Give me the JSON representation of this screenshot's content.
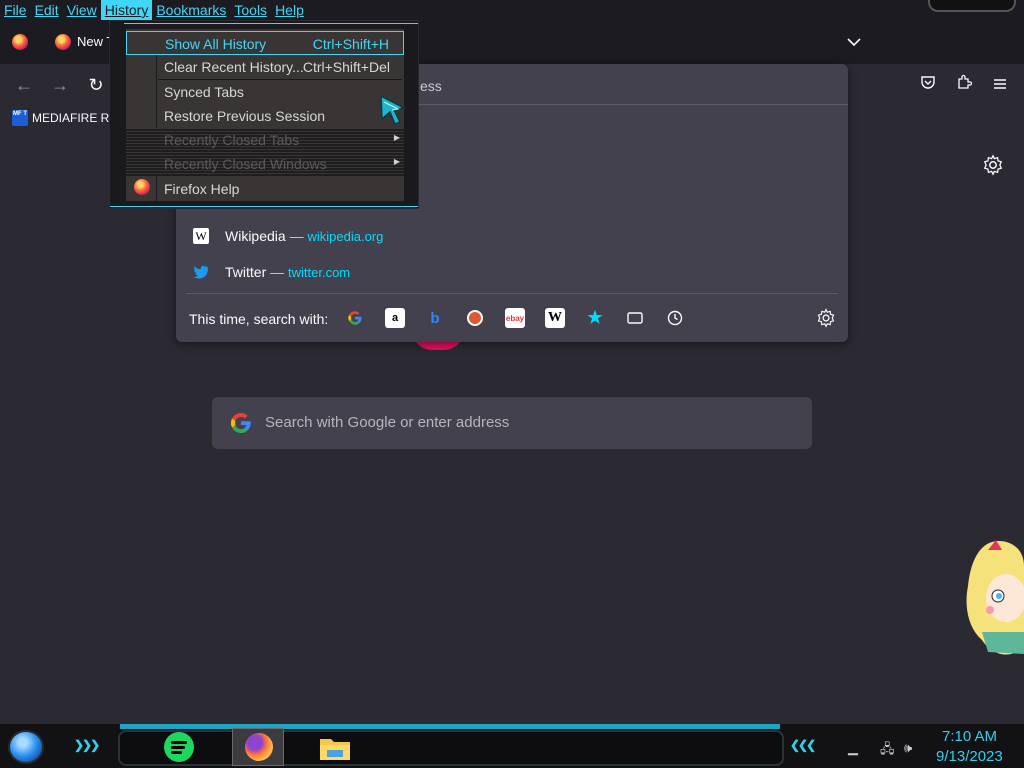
{
  "menubar": {
    "items": [
      "File",
      "Edit",
      "View",
      "History",
      "Bookmarks",
      "Tools",
      "Help"
    ]
  },
  "tabs": [
    {
      "label": "New T"
    }
  ],
  "toolbar": {
    "back_icon": "back-arrow-icon",
    "forward_icon": "forward-arrow-icon",
    "reload_icon": "reload-icon",
    "right_icons": [
      "pocket-icon",
      "extensions-icon",
      "menu-icon"
    ]
  },
  "bookmarks": [
    {
      "label": "MEDIAFIRE RO",
      "icon_text": "MF T"
    }
  ],
  "url_panel": {
    "input_text": "ess",
    "suggestions": [
      {
        "title": "Wikipedia",
        "dash": "—",
        "url": "wikipedia.org",
        "icon": "wikipedia-icon"
      },
      {
        "title": "Twitter",
        "dash": "—",
        "url": "twitter.com",
        "icon": "twitter-icon"
      }
    ],
    "search_with_label": "This time, search with:",
    "engines": [
      "google-icon",
      "amazon-icon",
      "bing-icon",
      "duckduckgo-icon",
      "ebay-icon",
      "wikipedia-icon",
      "bookmarks-star-icon",
      "tabs-icon",
      "history-clock-icon"
    ]
  },
  "main_search": {
    "placeholder": "Search with Google or enter address"
  },
  "history_menu": {
    "items": [
      {
        "label": "Show All History",
        "accel": "Ctrl+Shift+H",
        "state": "selected"
      },
      {
        "label": "Clear Recent History...",
        "accel": "Ctrl+Shift+Del",
        "state": "normal"
      },
      {
        "label": "Synced Tabs",
        "accel": "",
        "state": "normal"
      },
      {
        "label": "Restore Previous Session",
        "accel": "",
        "state": "normal"
      },
      {
        "label": "Recently Closed Tabs",
        "accel": "",
        "state": "disabled",
        "submenu": true
      },
      {
        "label": "Recently Closed Windows",
        "accel": "",
        "state": "disabled",
        "submenu": true
      },
      {
        "label": "Firefox Help",
        "accel": "",
        "state": "normal"
      }
    ]
  },
  "taskbar": {
    "time": "7:10 AM",
    "date": "9/13/2023",
    "apps": [
      "spotify-icon",
      "firefox-icon",
      "file-explorer-icon"
    ],
    "accent": "#2fd0e8"
  },
  "colors": {
    "accent_cyan": "#3fd7f5",
    "link_blue": "#00ddff",
    "page_bg": "#2b2a33",
    "panel_bg": "#42414d"
  }
}
